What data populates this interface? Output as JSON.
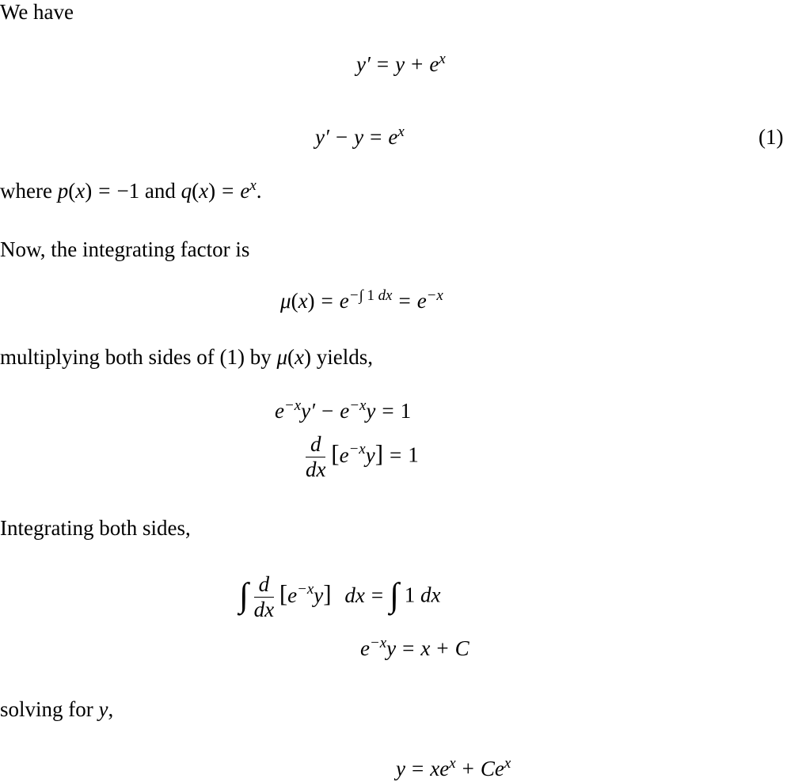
{
  "text": {
    "intro": "We have",
    "where_prefix": "where",
    "and": "and",
    "period": ".",
    "now": "Now, the integrating factor is",
    "multiplying": "multiplying both sides of (1) by",
    "yields": "yields,",
    "integrating": "Integrating both sides,",
    "solving": "solving for",
    "comma": ","
  },
  "equations": {
    "eq_label": "(1)",
    "p_of_x": "p(x) = −1",
    "q_of_x": "q(x) = e",
    "mu": "μ(x)",
    "minus_one": "−1",
    "one": "1",
    "d": "d",
    "dx": "dx",
    "C": "C"
  }
}
